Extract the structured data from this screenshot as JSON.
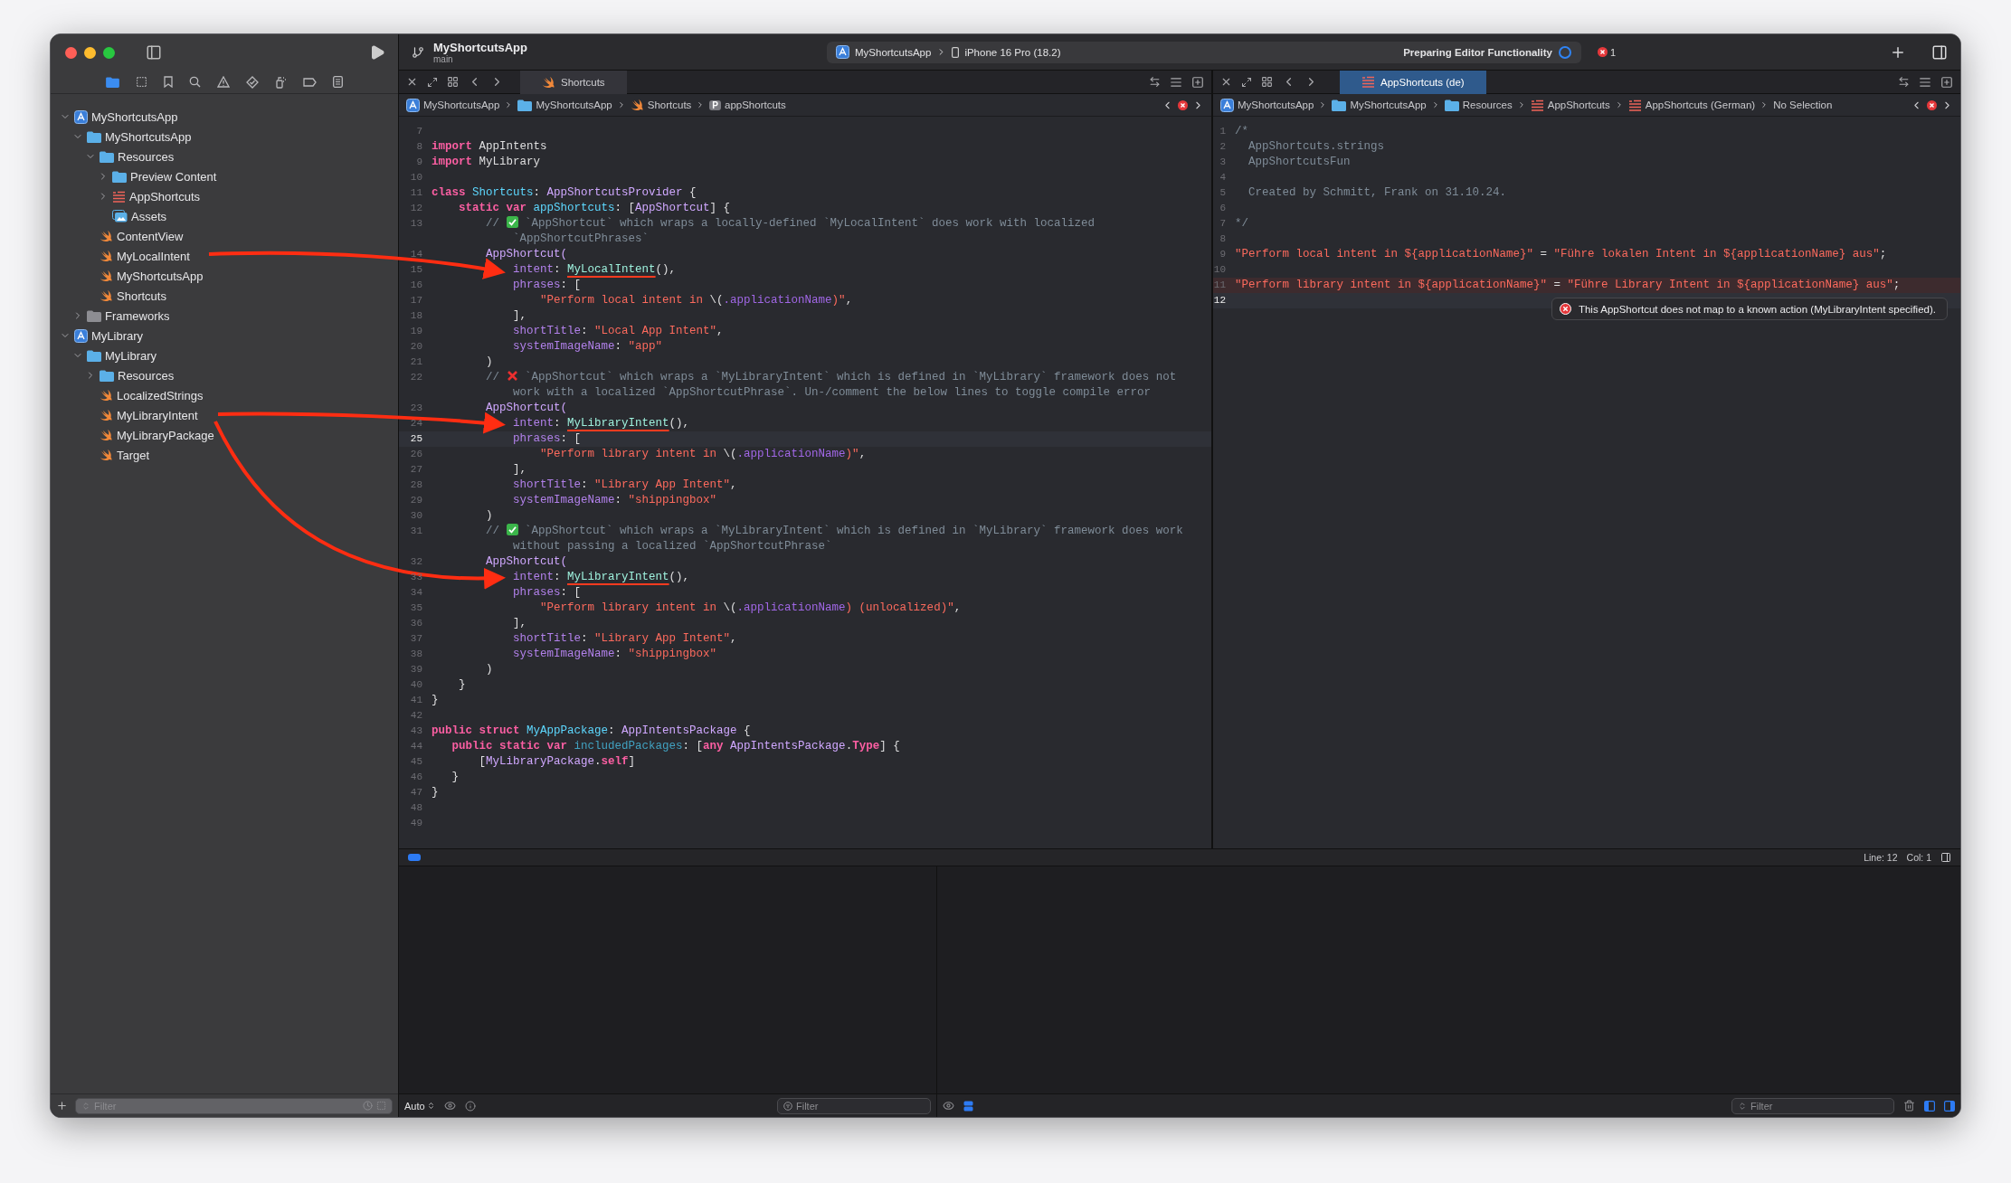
{
  "toolbar": {
    "project": "MyShortcutsApp",
    "branch": "main",
    "scheme": "MyShortcutsApp",
    "device": "iPhone 16 Pro (18.2)",
    "status": "Preparing Editor Functionality",
    "error_count": "1"
  },
  "navigator": {
    "tree": [
      {
        "label": "MyShortcutsApp",
        "kind": "project",
        "expanded": true,
        "children": [
          {
            "label": "MyShortcutsApp",
            "kind": "folder",
            "expanded": true,
            "children": [
              {
                "label": "Resources",
                "kind": "folder",
                "expanded": true,
                "children": [
                  {
                    "label": "Preview Content",
                    "kind": "folder",
                    "expanded": false
                  },
                  {
                    "label": "AppShortcuts",
                    "kind": "strings",
                    "expanded": false
                  },
                  {
                    "label": "Assets",
                    "kind": "assets"
                  }
                ]
              },
              {
                "label": "ContentView",
                "kind": "swift"
              },
              {
                "label": "MyLocalIntent",
                "kind": "swift"
              },
              {
                "label": "MyShortcutsApp",
                "kind": "swift"
              },
              {
                "label": "Shortcuts",
                "kind": "swift"
              }
            ]
          },
          {
            "label": "Frameworks",
            "kind": "framework-folder",
            "expanded": false
          }
        ]
      },
      {
        "label": "MyLibrary",
        "kind": "project",
        "expanded": true,
        "children": [
          {
            "label": "MyLibrary",
            "kind": "folder",
            "expanded": true,
            "children": [
              {
                "label": "Resources",
                "kind": "folder",
                "expanded": false
              },
              {
                "label": "LocalizedStrings",
                "kind": "swift"
              },
              {
                "label": "MyLibraryIntent",
                "kind": "swift"
              },
              {
                "label": "MyLibraryPackage",
                "kind": "swift"
              },
              {
                "label": "Target",
                "kind": "swift"
              }
            ]
          }
        ]
      }
    ],
    "filter": {
      "placeholder": "Filter"
    }
  },
  "editors": [
    {
      "focused": false,
      "tab": {
        "label": "Shortcuts",
        "kind": "swift"
      },
      "breadcrumbs": [
        {
          "kind": "project",
          "label": "MyShortcutsApp"
        },
        {
          "kind": "folder",
          "label": "MyShortcutsApp"
        },
        {
          "kind": "swift",
          "label": "Shortcuts"
        },
        {
          "kind": "symbol",
          "badge": "P",
          "label": "appShortcuts"
        }
      ],
      "lines": [
        {
          "n": "7",
          "current": false
        },
        {
          "n": "8",
          "current": false,
          "tokens": [
            {
              "kind": "keyword",
              "text": "import"
            },
            {
              "kind": "plain",
              "text": " AppIntents"
            }
          ]
        },
        {
          "n": "9",
          "current": false,
          "tokens": [
            {
              "kind": "keyword",
              "text": "import"
            },
            {
              "kind": "plain",
              "text": " MyLibrary"
            }
          ]
        },
        {
          "n": "10",
          "current": false
        },
        {
          "n": "11",
          "current": false,
          "tokens": [
            {
              "kind": "keyword",
              "text": "class"
            },
            {
              "kind": "decl",
              "text": " Shortcuts"
            },
            {
              "kind": "plain",
              "text": ": "
            },
            {
              "kind": "type",
              "text": "AppShortcutsProvider"
            },
            {
              "kind": "plain",
              "text": " {"
            }
          ]
        },
        {
          "n": "12",
          "current": false,
          "tokens": [
            {
              "kind": "keyword",
              "text": "    static var"
            },
            {
              "kind": "decl",
              "text": " appShortcuts"
            },
            {
              "kind": "plain",
              "text": ": ["
            },
            {
              "kind": "type",
              "text": "AppShortcut"
            },
            {
              "kind": "plain",
              "text": "] {"
            }
          ]
        },
        {
          "n": "13",
          "current": false,
          "tokens": [
            {
              "kind": "comment",
              "text": "        // "
            },
            {
              "kind": "check"
            },
            {
              "kind": "comment",
              "text": " `AppShortcut` which wraps a locally-defined `MyLocalIntent` does work with localized"
            }
          ],
          "wrap": "`AppShortcutPhrases`"
        },
        {
          "n": "14",
          "current": false,
          "tokens": [
            {
              "kind": "type",
              "text": "        AppShortcut("
            }
          ]
        },
        {
          "n": "15",
          "current": false,
          "tokens": [
            {
              "kind": "label",
              "text": "            intent"
            },
            {
              "kind": "plain",
              "text": ": "
            },
            {
              "kind": "marked",
              "text": "MyLocalIntent"
            },
            {
              "kind": "plain",
              "text": "(),"
            }
          ]
        },
        {
          "n": "16",
          "current": false,
          "tokens": [
            {
              "kind": "label",
              "text": "            phrases"
            },
            {
              "kind": "plain",
              "text": ": ["
            }
          ]
        },
        {
          "n": "17",
          "current": false,
          "tokens": [
            {
              "kind": "string",
              "text": "                \"Perform local intent in "
            },
            {
              "kind": "plain",
              "text": "\\("
            },
            {
              "kind": "member",
              "text": ".applicationName"
            },
            {
              "kind": "string",
              "text": ")\""
            },
            {
              "kind": "plain",
              "text": ","
            }
          ]
        },
        {
          "n": "18",
          "current": false,
          "tokens": [
            {
              "kind": "plain",
              "text": "            ],"
            }
          ]
        },
        {
          "n": "19",
          "current": false,
          "tokens": [
            {
              "kind": "label",
              "text": "            shortTitle"
            },
            {
              "kind": "plain",
              "text": ": "
            },
            {
              "kind": "string",
              "text": "\"Local App Intent\""
            },
            {
              "kind": "plain",
              "text": ","
            }
          ]
        },
        {
          "n": "20",
          "current": false,
          "tokens": [
            {
              "kind": "label",
              "text": "            systemImageName"
            },
            {
              "kind": "plain",
              "text": ": "
            },
            {
              "kind": "string",
              "text": "\"app\""
            }
          ]
        },
        {
          "n": "21",
          "current": false,
          "tokens": [
            {
              "kind": "plain",
              "text": "        )"
            }
          ]
        },
        {
          "n": "22",
          "current": false,
          "tokens": [
            {
              "kind": "comment",
              "text": "        // "
            },
            {
              "kind": "cross"
            },
            {
              "kind": "comment",
              "text": " `AppShortcut` which wraps a `MyLibraryIntent` which is defined in `MyLibrary` framework does not"
            }
          ],
          "wrap": "work with a localized `AppShortcutPhrase`. Un-/comment the below lines to toggle compile error"
        },
        {
          "n": "23",
          "current": false,
          "tokens": [
            {
              "kind": "type",
              "text": "        AppShortcut("
            }
          ]
        },
        {
          "n": "24",
          "current": false,
          "tokens": [
            {
              "kind": "label",
              "text": "            intent"
            },
            {
              "kind": "plain",
              "text": ": "
            },
            {
              "kind": "marked",
              "text": "MyLibraryIntent"
            },
            {
              "kind": "plain",
              "text": "(),"
            }
          ]
        },
        {
          "n": "25",
          "current": true,
          "tokens": [
            {
              "kind": "label",
              "text": "            phrases"
            },
            {
              "kind": "plain",
              "text": ": ["
            }
          ]
        },
        {
          "n": "26",
          "current": false,
          "tokens": [
            {
              "kind": "string",
              "text": "                \"Perform library intent in "
            },
            {
              "kind": "plain",
              "text": "\\("
            },
            {
              "kind": "member",
              "text": ".applicationName"
            },
            {
              "kind": "string",
              "text": ")\""
            },
            {
              "kind": "plain",
              "text": ","
            }
          ]
        },
        {
          "n": "27",
          "current": false,
          "tokens": [
            {
              "kind": "plain",
              "text": "            ],"
            }
          ]
        },
        {
          "n": "28",
          "current": false,
          "tokens": [
            {
              "kind": "label",
              "text": "            shortTitle"
            },
            {
              "kind": "plain",
              "text": ": "
            },
            {
              "kind": "string",
              "text": "\"Library App Intent\""
            },
            {
              "kind": "plain",
              "text": ","
            }
          ]
        },
        {
          "n": "29",
          "current": false,
          "tokens": [
            {
              "kind": "label",
              "text": "            systemImageName"
            },
            {
              "kind": "plain",
              "text": ": "
            },
            {
              "kind": "string",
              "text": "\"shippingbox\""
            }
          ]
        },
        {
          "n": "30",
          "current": false,
          "tokens": [
            {
              "kind": "plain",
              "text": "        )"
            }
          ]
        },
        {
          "n": "31",
          "current": false,
          "tokens": [
            {
              "kind": "comment",
              "text": "        // "
            },
            {
              "kind": "check"
            },
            {
              "kind": "comment",
              "text": " `AppShortcut` which wraps a `MyLibraryIntent` which is defined in `MyLibrary` framework does work"
            }
          ],
          "wrap": "without passing a localized `AppShortcutPhrase`"
        },
        {
          "n": "32",
          "current": false,
          "tokens": [
            {
              "kind": "type",
              "text": "        AppShortcut("
            }
          ]
        },
        {
          "n": "33",
          "current": false,
          "tokens": [
            {
              "kind": "label",
              "text": "            intent"
            },
            {
              "kind": "plain",
              "text": ": "
            },
            {
              "kind": "marked",
              "text": "MyLibraryIntent"
            },
            {
              "kind": "plain",
              "text": "(),"
            }
          ]
        },
        {
          "n": "34",
          "current": false,
          "tokens": [
            {
              "kind": "label",
              "text": "            phrases"
            },
            {
              "kind": "plain",
              "text": ": ["
            }
          ]
        },
        {
          "n": "35",
          "current": false,
          "tokens": [
            {
              "kind": "string",
              "text": "                \"Perform library intent in "
            },
            {
              "kind": "plain",
              "text": "\\("
            },
            {
              "kind": "member",
              "text": ".applicationName"
            },
            {
              "kind": "string",
              "text": ") (unlocalized)\""
            },
            {
              "kind": "plain",
              "text": ","
            }
          ]
        },
        {
          "n": "36",
          "current": false,
          "tokens": [
            {
              "kind": "plain",
              "text": "            ],"
            }
          ]
        },
        {
          "n": "37",
          "current": false,
          "tokens": [
            {
              "kind": "label",
              "text": "            shortTitle"
            },
            {
              "kind": "plain",
              "text": ": "
            },
            {
              "kind": "string",
              "text": "\"Library App Intent\""
            },
            {
              "kind": "plain",
              "text": ","
            }
          ]
        },
        {
          "n": "38",
          "current": false,
          "tokens": [
            {
              "kind": "label",
              "text": "            systemImageName"
            },
            {
              "kind": "plain",
              "text": ": "
            },
            {
              "kind": "string",
              "text": "\"shippingbox\""
            }
          ]
        },
        {
          "n": "39",
          "current": false,
          "tokens": [
            {
              "kind": "plain",
              "text": "        )"
            }
          ]
        },
        {
          "n": "40",
          "current": false,
          "tokens": [
            {
              "kind": "plain",
              "text": "    }"
            }
          ]
        },
        {
          "n": "41",
          "current": false,
          "tokens": [
            {
              "kind": "plain",
              "text": "}"
            }
          ]
        },
        {
          "n": "42",
          "current": false
        },
        {
          "n": "43",
          "current": false,
          "tokens": [
            {
              "kind": "keyword",
              "text": "public struct"
            },
            {
              "kind": "decl",
              "text": " MyAppPackage"
            },
            {
              "kind": "plain",
              "text": ": "
            },
            {
              "kind": "type",
              "text": "AppIntentsPackage"
            },
            {
              "kind": "plain",
              "text": " {"
            }
          ]
        },
        {
          "n": "44",
          "current": false,
          "tokens": [
            {
              "kind": "keyword",
              "text": "   public static var"
            },
            {
              "kind": "decl2",
              "text": " includedPackages"
            },
            {
              "kind": "plain",
              "text": ": ["
            },
            {
              "kind": "keyword",
              "text": "any"
            },
            {
              "kind": "type",
              "text": " AppIntentsPackage"
            },
            {
              "kind": "plain",
              "text": "."
            },
            {
              "kind": "keyword",
              "text": "Type"
            },
            {
              "kind": "plain",
              "text": "] {"
            }
          ]
        },
        {
          "n": "45",
          "current": false,
          "tokens": [
            {
              "kind": "plain",
              "text": "       ["
            },
            {
              "kind": "type",
              "text": "MyLibraryPackage"
            },
            {
              "kind": "plain",
              "text": "."
            },
            {
              "kind": "keyword",
              "text": "self"
            },
            {
              "kind": "plain",
              "text": "]"
            }
          ]
        },
        {
          "n": "46",
          "current": false,
          "tokens": [
            {
              "kind": "plain",
              "text": "   }"
            }
          ]
        },
        {
          "n": "47",
          "current": false,
          "tokens": [
            {
              "kind": "plain",
              "text": "}"
            }
          ]
        },
        {
          "n": "48",
          "current": false
        },
        {
          "n": "49",
          "current": false
        }
      ]
    },
    {
      "focused": true,
      "tab": {
        "label": "AppShortcuts (de)",
        "kind": "strings"
      },
      "breadcrumbs": [
        {
          "kind": "project",
          "label": "MyShortcutsApp"
        },
        {
          "kind": "folder",
          "label": "MyShortcutsApp"
        },
        {
          "kind": "folder",
          "label": "Resources"
        },
        {
          "kind": "strings",
          "label": "AppShortcuts"
        },
        {
          "kind": "strings",
          "label": "AppShortcuts (German)"
        },
        {
          "kind": "none",
          "label": "No Selection"
        }
      ],
      "issue": "This AppShortcut does not map to a known action (MyLibraryIntent specified).",
      "lines": [
        {
          "n": "1",
          "current": false,
          "error": false,
          "tokens": [
            {
              "kind": "comment",
              "text": "/*"
            }
          ]
        },
        {
          "n": "2",
          "current": false,
          "error": false,
          "tokens": [
            {
              "kind": "comment",
              "text": "  AppShortcuts.strings"
            }
          ]
        },
        {
          "n": "3",
          "current": false,
          "error": false,
          "tokens": [
            {
              "kind": "comment",
              "text": "  AppShortcutsFun"
            }
          ]
        },
        {
          "n": "4",
          "current": false,
          "error": false
        },
        {
          "n": "5",
          "current": false,
          "error": false,
          "tokens": [
            {
              "kind": "comment",
              "text": "  Created by Schmitt, Frank on 31.10.24."
            }
          ]
        },
        {
          "n": "6",
          "current": false,
          "error": false
        },
        {
          "n": "7",
          "current": false,
          "error": false,
          "tokens": [
            {
              "kind": "comment",
              "text": "*/"
            }
          ]
        },
        {
          "n": "8",
          "current": false,
          "error": false
        },
        {
          "n": "9",
          "current": false,
          "error": false,
          "tokens": [
            {
              "kind": "string",
              "text": "\"Perform local intent in ${applicationName}\""
            },
            {
              "kind": "plain",
              "text": " = "
            },
            {
              "kind": "string",
              "text": "\"Führe lokalen Intent in ${applicationName} aus\""
            },
            {
              "kind": "plain",
              "text": ";"
            }
          ]
        },
        {
          "n": "10",
          "current": false,
          "error": false
        },
        {
          "n": "11",
          "current": false,
          "error": true,
          "tokens": [
            {
              "kind": "string",
              "text": "\"Perform library intent in ${applicationName}\""
            },
            {
              "kind": "plain",
              "text": " = "
            },
            {
              "kind": "string",
              "text": "\"Führe Library Intent in ${applicationName} aus\""
            },
            {
              "kind": "plain",
              "text": ";"
            }
          ]
        },
        {
          "n": "12",
          "current": true,
          "error": false
        }
      ]
    }
  ],
  "status": {
    "line": "Line: 12",
    "column": "Col: 1"
  },
  "debug": {
    "mode": "Auto",
    "variables_filter": {
      "placeholder": "Filter"
    },
    "console_filter": {
      "placeholder": "Filter"
    }
  }
}
